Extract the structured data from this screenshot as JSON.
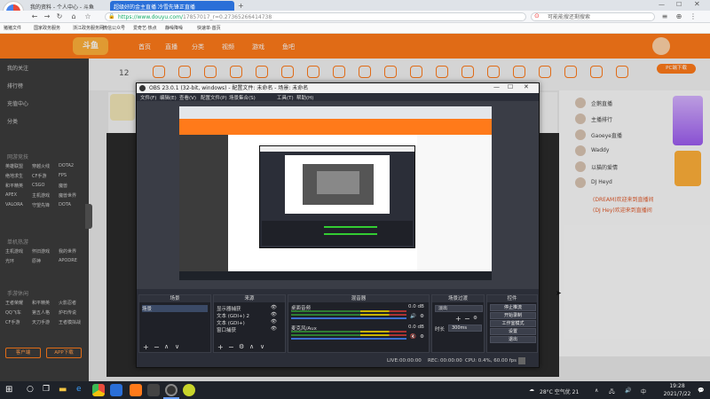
{
  "browser": {
    "tabs": [
      {
        "label": "我的资料 - 个人中心 - 斗鱼",
        "active": false
      },
      {
        "label": "超级好的金主直播 冷雪先锋正直播",
        "active": true
      }
    ],
    "url_domain": "https://www.douyu.com/",
    "url_path": "17857017_r=0.27365266414738",
    "search_placeholder": "可能能搜还剩搜索",
    "bookmarks": [
      "猪猪文件",
      "国家政务服务",
      "浙江政务服务网",
      "微信公众号",
      "爱奇艺·热点",
      "静噪降噪",
      "快速单·首页"
    ]
  },
  "site": {
    "logo": "斗鱼",
    "nav": [
      "首页",
      "直播",
      "分类",
      "视频",
      "游戏",
      "鱼吧"
    ],
    "sidebar_top": [
      "我的关注",
      "排行榜",
      "充值中心",
      "分类"
    ],
    "sidebar_sections": [
      {
        "title": "网游竞技",
        "items": [
          "英雄联盟",
          "穿越火线",
          "DOTA2",
          "绝地求生",
          "CF手游",
          "FPS",
          "和平精英",
          "CSGO",
          "魔兽",
          "APEX",
          "主机游戏",
          "魔兽世界",
          "VALORA",
          "守望先锋",
          "DOTA"
        ]
      },
      {
        "title": "单机热游",
        "items": [
          "主机游戏",
          "怀旧游戏",
          "我的世界",
          "光环",
          "原神",
          "APODRE"
        ]
      },
      {
        "title": "手游休闲",
        "items": [
          "王者荣耀",
          "和平精英",
          "火影忍者",
          "QQ飞车",
          "第五人格",
          "炉石传说",
          "CF手游",
          "天刀手游",
          "王者模拟战"
        ]
      }
    ],
    "sidebar_buttons": [
      "客户端",
      "APP下载"
    ],
    "category_count": "12",
    "right_items": [
      "企鹅直播",
      "主播排行",
      "Gaoeye直播",
      "Waddy",
      "以猫的爱情",
      "DJ Heyd"
    ],
    "right_links": [
      "(DREAM)欢迎来到直播间",
      "(DJ Hey)欢迎来到直播间"
    ],
    "pc_btn": "PC端下载"
  },
  "obs": {
    "title": "OBS 23.0.1 (32-bit, windows) - 配置文件: 未命名 - 场景: 未命名",
    "menu": [
      "文件(F)",
      "编辑(E)",
      "查看(V)",
      "配置文件(P)",
      "场景集合(S)",
      "工具(T)",
      "帮助(H)"
    ],
    "docks": {
      "scenes": {
        "title": "场景",
        "items": [
          "场景"
        ]
      },
      "sources": {
        "title": "来源",
        "items": [
          "显示器捕获",
          "文本 (GDI+) 2",
          "文本 (GDI+)",
          "窗口捕获"
        ]
      },
      "mixer": {
        "title": "混音器",
        "channels": [
          {
            "name": "桌面音频",
            "db": "0.0 dB"
          },
          {
            "name": "麦克风/Aux",
            "db": "0.0 dB"
          }
        ]
      },
      "transitions": {
        "title": "场景过渡",
        "type": "淡出",
        "duration_label": "时长",
        "duration": "300ms"
      },
      "controls": {
        "title": "控件",
        "buttons": [
          "停止推流",
          "开始录制",
          "工作室模式",
          "设置",
          "退出"
        ]
      }
    },
    "status": {
      "live_label": "LIVE:",
      "live_time": "00:00:00",
      "rec_label": "REC:",
      "rec_time": "00:00:00",
      "cpu": "CPU: 0.4%, 60.00 fps"
    }
  },
  "taskbar": {
    "weather": "28°C 空气优 21",
    "ime": "中",
    "time": "19:28",
    "date": "2021/7/22"
  }
}
